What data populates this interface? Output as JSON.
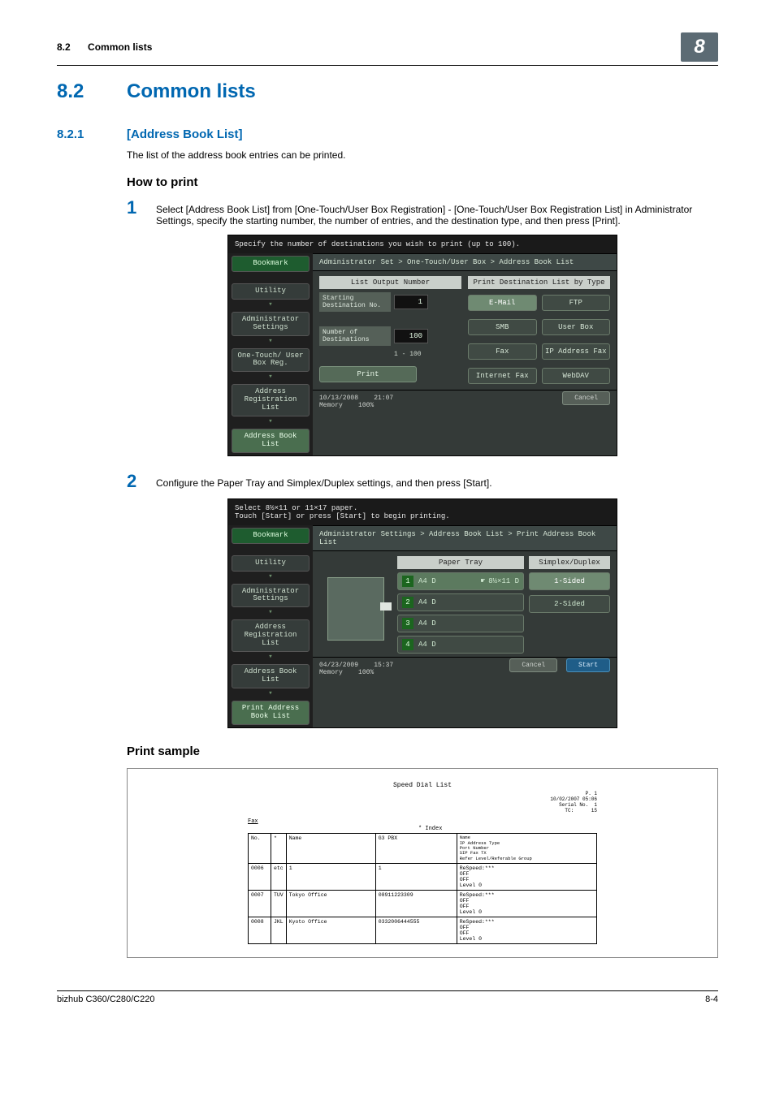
{
  "header": {
    "section_no": "8.2",
    "section_name": "Common lists",
    "chapter_tab": "8"
  },
  "section": {
    "num": "8.2",
    "title": "Common lists"
  },
  "subsection": {
    "num": "8.2.1",
    "title": "[Address Book List]",
    "intro": "The list of the address book entries can be printed.",
    "howto": "How to print",
    "step1": "Select [Address Book List] from [One-Touch/User Box Registration] - [One-Touch/User Box Registration List] in Administrator Settings, specify the starting number, the number of entries, and the destination type, and then press [Print].",
    "step2": "Configure the Paper Tray and Simplex/Duplex settings, and then press [Start]."
  },
  "panel1": {
    "topmsg": "Specify the number of destinations you wish to print (up to 100).",
    "crumb": "Administrator Set > One-Touch/User Box > Address Book List",
    "left_bar": "List Output Number",
    "right_bar": "Print Destination List by Type",
    "starting_lbl": "Starting Destination No.",
    "starting_val": "1",
    "number_lbl": "Number of Destinations",
    "number_val": "100",
    "range": "1  -   100",
    "types": [
      "E-Mail",
      "FTP",
      "SMB",
      "User Box",
      "Fax",
      "IP Address Fax",
      "Internet Fax",
      "WebDAV"
    ],
    "print": "Print",
    "side": {
      "bookmark": "Bookmark",
      "utility": "Utility",
      "admin": "Administrator Settings",
      "onetouch": "One-Touch/ User Box Reg.",
      "addrreg": "Address Registration List",
      "addrbook": "Address Book List"
    },
    "foot_date": "10/13/2008",
    "foot_time": "21:07",
    "foot_mem_l": "Memory",
    "foot_mem_v": "100%",
    "cancel": "Cancel"
  },
  "panel2": {
    "topmsg1": "Select 8½×11 or 11×17 paper.",
    "topmsg2": "Touch [Start] or press [Start] to begin printing.",
    "crumb": "Administrator Settings > Address Book List > Print Address Book List",
    "tray_hd": "Paper Tray",
    "dup_hd": "Simplex/Duplex",
    "trays": [
      {
        "n": "1",
        "label": "A4 D",
        "extra": "8½×11 D",
        "sel": true
      },
      {
        "n": "2",
        "label": "A4 D"
      },
      {
        "n": "3",
        "label": "A4 D"
      },
      {
        "n": "4",
        "label": "A4 D"
      }
    ],
    "sided1": "1-Sided",
    "sided2": "2-Sided",
    "side": {
      "bookmark": "Bookmark",
      "utility": "Utility",
      "admin": "Administrator Settings",
      "addrreg": "Address Registration List",
      "addrbook": "Address Book List",
      "printlist": "Print Address Book List"
    },
    "foot_date": "04/23/2009",
    "foot_time": "15:37",
    "foot_mem_l": "Memory",
    "foot_mem_v": "100%",
    "cancel": "Cancel",
    "start": "Start"
  },
  "sample": {
    "heading": "Print sample",
    "title": "Speed Dial List",
    "meta_p": "P.  1",
    "meta_dt": "10/02/2007 05:06",
    "meta_serial_l": "Serial No.",
    "meta_serial_v": "1",
    "meta_tc_l": "TC:",
    "meta_tc_v": "15",
    "fax_label": "Fax",
    "index_label": "* Index",
    "th_no": "No.",
    "th_star": "*",
    "th_name": "Name",
    "th_line": "G3 PBX",
    "legend": "Name\nIP Address Type\nPort Number\nSIP Fax TX\nRefer Level/Referable Group",
    "rows": [
      {
        "no": "0006",
        "idx": "etc",
        "name": "1",
        "line": "1",
        "right": "ReSpeed:***\nOFF\nOFF\nLevel 0"
      },
      {
        "no": "0007",
        "idx": "TUV",
        "name": "Tokyo Office",
        "line": "08911223309",
        "right": "ReSpeed:***\nOFF\nOFF\nLevel 0"
      },
      {
        "no": "0008",
        "idx": "JKL",
        "name": "Kyoto Office",
        "line": "0332006444555",
        "right": "ReSpeed:***\nOFF\nOFF\nLevel 0"
      }
    ]
  },
  "footer": {
    "left": "bizhub C360/C280/C220",
    "right": "8-4"
  }
}
